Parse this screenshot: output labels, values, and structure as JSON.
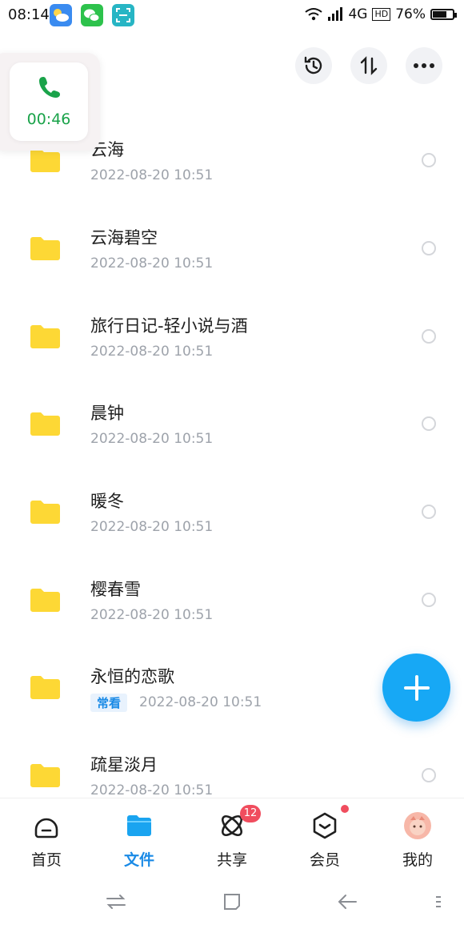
{
  "status_bar": {
    "time": "08:14",
    "network": "4G",
    "hd": "HD",
    "battery_percent": "76%",
    "battery_level": 0.76,
    "apps": [
      "weather-icon",
      "wechat-icon",
      "scan-icon"
    ]
  },
  "call_window": {
    "duration": "00:46",
    "accent": "#1aa34a"
  },
  "header_actions": [
    "history-icon",
    "sort-icon",
    "more-icon"
  ],
  "files": [
    {
      "name": "云海",
      "date": "2022-08-20  10:51",
      "badge": ""
    },
    {
      "name": "云海碧空",
      "date": "2022-08-20  10:51",
      "badge": ""
    },
    {
      "name": "旅行日记-轻小说与酒",
      "date": "2022-08-20  10:51",
      "badge": ""
    },
    {
      "name": "晨钟",
      "date": "2022-08-20  10:51",
      "badge": ""
    },
    {
      "name": "暖冬",
      "date": "2022-08-20  10:51",
      "badge": ""
    },
    {
      "name": "樱春雪",
      "date": "2022-08-20  10:51",
      "badge": ""
    },
    {
      "name": "永恒的恋歌",
      "date": "2022-08-20  10:51",
      "badge": "常看"
    },
    {
      "name": "疏星淡月",
      "date": "2022-08-20  10:51",
      "badge": ""
    }
  ],
  "nav": {
    "tabs": [
      {
        "label": "首页",
        "icon": "home-icon"
      },
      {
        "label": "文件",
        "icon": "folder-icon"
      },
      {
        "label": "共享",
        "icon": "share-orbit-icon",
        "badge": "12"
      },
      {
        "label": "会员",
        "icon": "member-icon"
      },
      {
        "label": "我的",
        "icon": "avatar-icon"
      }
    ],
    "active": "文件"
  },
  "colors": {
    "accent": "#1a8ae6",
    "folder": "#fdd835",
    "badge": "#f04d5e",
    "fab": "#17a8f5"
  }
}
